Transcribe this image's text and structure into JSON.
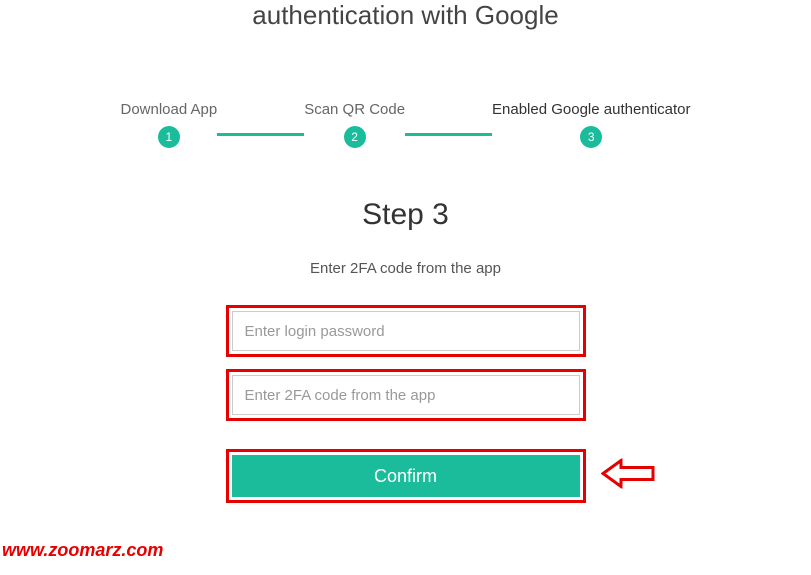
{
  "header": {
    "title": "authentication with Google"
  },
  "stepper": {
    "steps": [
      {
        "number": "1",
        "label": "Download App",
        "active": false
      },
      {
        "number": "2",
        "label": "Scan QR Code",
        "active": false
      },
      {
        "number": "3",
        "label": "Enabled Google authenticator",
        "active": true
      }
    ]
  },
  "main": {
    "heading": "Step 3",
    "instruction": "Enter 2FA code from the app",
    "password_placeholder": "Enter login password",
    "code_placeholder": "Enter 2FA code from the app",
    "confirm_label": "Confirm"
  },
  "watermark": "www.zoomarz.com",
  "colors": {
    "accent": "#1abc9c",
    "highlight": "#e60000"
  }
}
